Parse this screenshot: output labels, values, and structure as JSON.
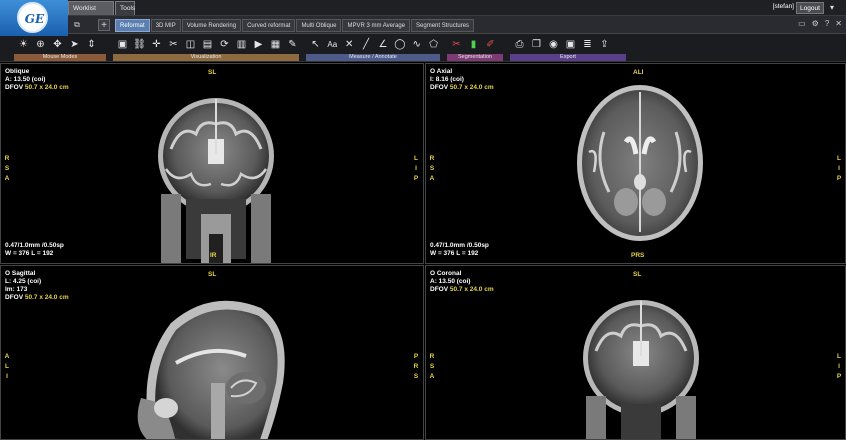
{
  "topbar": {
    "logo_text": "GE",
    "tabs": [
      "Worklist Browser",
      "Tools"
    ],
    "user": "[stefan]",
    "logout": "Logout",
    "icons": [
      "dropdown-icon",
      "settings-icon",
      "help-icon",
      "close-icon"
    ]
  },
  "modes": [
    "Reformat",
    "3D MIP",
    "Volume Rendering",
    "Curved reformat",
    "Multi Oblique",
    "MPVR 3 mm Average",
    "Segment Structures"
  ],
  "toolbar": {
    "groups": [
      {
        "label": "Mouse Modes"
      },
      {
        "label": "Visualization"
      },
      {
        "label": "Measure / Annotate"
      },
      {
        "label": "Segmentation"
      },
      {
        "label": "Export"
      }
    ]
  },
  "viewports": {
    "top_left": {
      "title": "Oblique",
      "pos_label": "A:",
      "pos_value": "13.50 (coi)",
      "dfov_label": "DFOV",
      "dfov_value": "50.7 x 24.0 cm",
      "top": "SL",
      "bottom": "IR",
      "left": [
        "R",
        "S",
        "A"
      ],
      "right": [
        "L",
        "I",
        "P"
      ],
      "slice": "0.47/1.0mm /0.50sp",
      "wl": "W = 376 L = 192"
    },
    "top_right": {
      "title": "O Axial",
      "pos_label": "I:",
      "pos_value": "8.16 (coi)",
      "dfov_label": "DFOV",
      "dfov_value": "50.7 x 24.0 cm",
      "top": "ALI",
      "bottom": "PRS",
      "left": [
        "R",
        "S",
        "A"
      ],
      "right": [
        "L",
        "I",
        "P"
      ],
      "slice": "0.47/1.0mm /0.50sp",
      "wl": "W = 376 L = 192"
    },
    "bottom_left": {
      "title": "O Sagittal",
      "pos_label": "L:",
      "pos_value": "4.25 (coi)",
      "im": "Im: 173",
      "dfov_label": "DFOV",
      "dfov_value": "50.7 x 24.0 cm",
      "top": "SL",
      "left": [
        "A",
        "L",
        "I"
      ],
      "right": [
        "P",
        "R",
        "S"
      ]
    },
    "bottom_right": {
      "title": "O Coronal",
      "pos_label": "A:",
      "pos_value": "13.50 (coi)",
      "dfov_label": "DFOV",
      "dfov_value": "50.7 x 24.0 cm",
      "top": "SL",
      "left": [
        "R",
        "S",
        "A"
      ],
      "right": [
        "L",
        "I",
        "P"
      ]
    }
  }
}
